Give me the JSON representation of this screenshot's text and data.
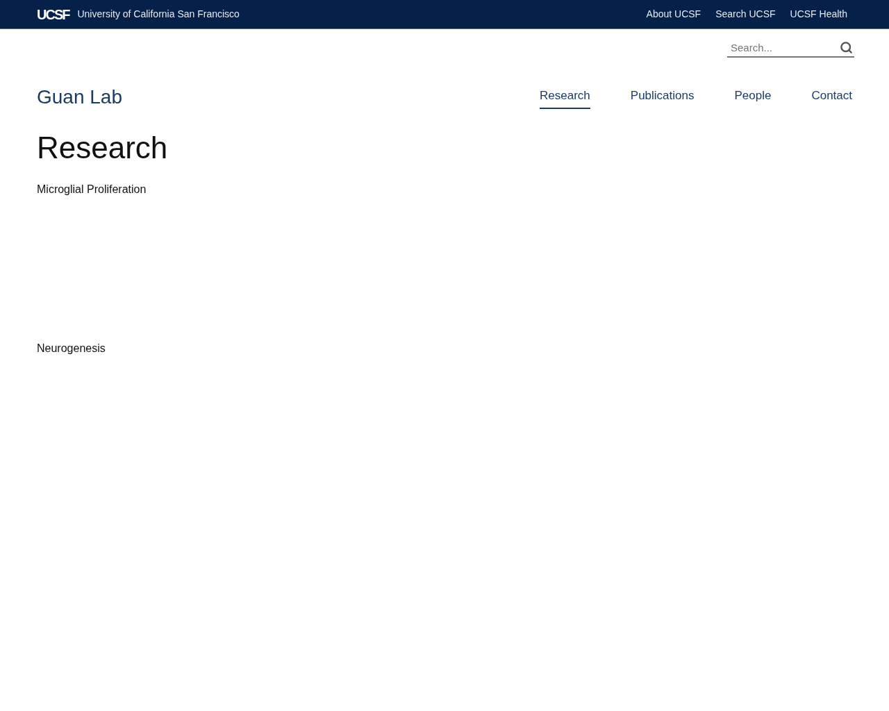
{
  "top_bar": {
    "logo": "UCSF",
    "university": "University of California San Francisco",
    "links": [
      "About UCSF",
      "Search UCSF",
      "UCSF Health"
    ]
  },
  "search": {
    "placeholder": "Search..."
  },
  "site_title": "Guan Lab",
  "nav": [
    {
      "label": "Research",
      "selected": true
    },
    {
      "label": "Publications",
      "selected": false
    },
    {
      "label": "People",
      "selected": false
    },
    {
      "label": "Contact",
      "selected": false
    }
  ],
  "page_title": "Research",
  "sections": [
    "Microglial Proliferation",
    "Neurogenesis"
  ]
}
